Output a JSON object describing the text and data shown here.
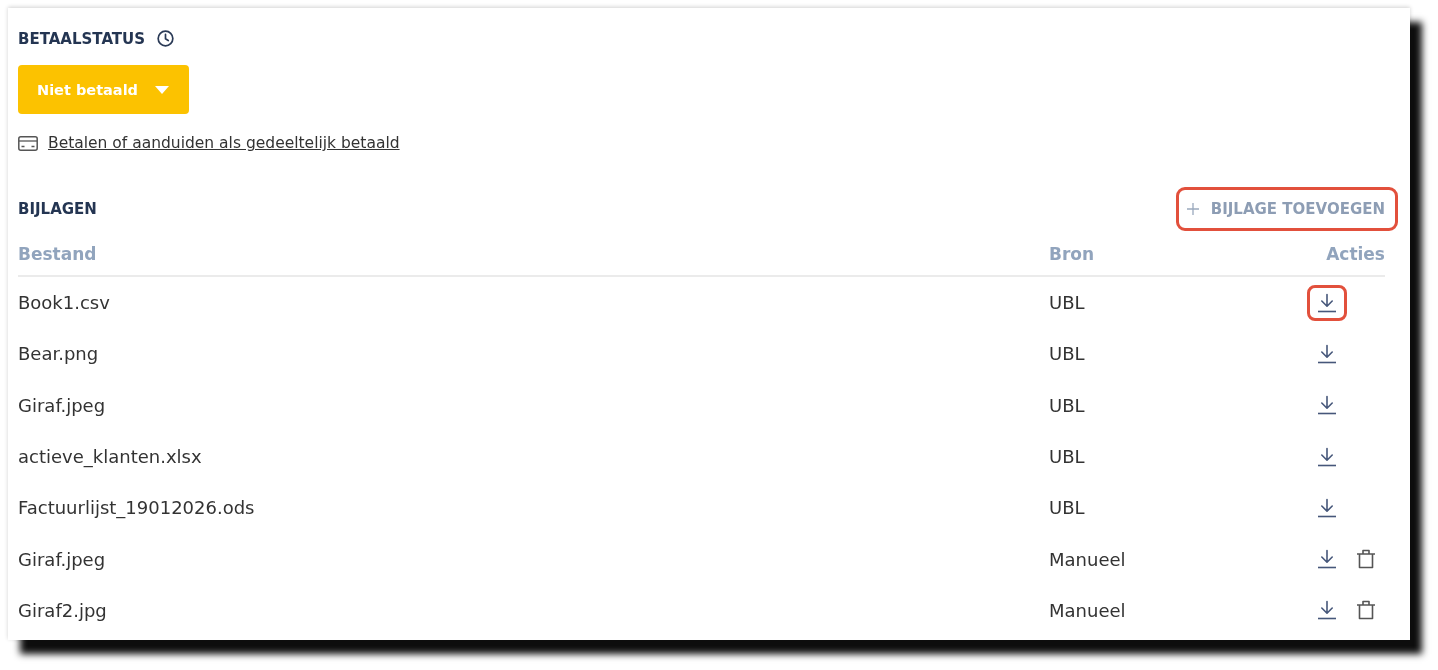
{
  "payment_status": {
    "title": "BETAALSTATUS",
    "status_button": {
      "label": "Niet betaald"
    },
    "link": "Betalen of aanduiden als gedeeltelijk betaald"
  },
  "attachments": {
    "title": "BIJLAGEN",
    "add_button": {
      "label": "BIJLAGE TOEVOEGEN",
      "highlighted": true
    },
    "columns": [
      "Bestand",
      "Bron",
      "Acties"
    ],
    "rows": [
      {
        "file": "Book1.csv",
        "source": "UBL",
        "actions": [
          {
            "kind": "download",
            "highlighted": true
          }
        ]
      },
      {
        "file": "Bear.png",
        "source": "UBL",
        "actions": [
          {
            "kind": "download",
            "highlighted": false
          }
        ]
      },
      {
        "file": "Giraf.jpeg",
        "source": "UBL",
        "actions": [
          {
            "kind": "download",
            "highlighted": false
          }
        ]
      },
      {
        "file": "actieve_klanten.xlsx",
        "source": "UBL",
        "actions": [
          {
            "kind": "download",
            "highlighted": false
          }
        ]
      },
      {
        "file": "Factuurlijst_19012026.ods",
        "source": "UBL",
        "actions": [
          {
            "kind": "download",
            "highlighted": false
          }
        ]
      },
      {
        "file": "Giraf.jpeg",
        "source": "Manueel",
        "actions": [
          {
            "kind": "download",
            "highlighted": false
          },
          {
            "kind": "delete",
            "highlighted": false
          }
        ]
      },
      {
        "file": "Giraf2.jpg",
        "source": "Manueel",
        "actions": [
          {
            "kind": "download",
            "highlighted": false
          },
          {
            "kind": "delete",
            "highlighted": false
          }
        ]
      }
    ]
  }
}
